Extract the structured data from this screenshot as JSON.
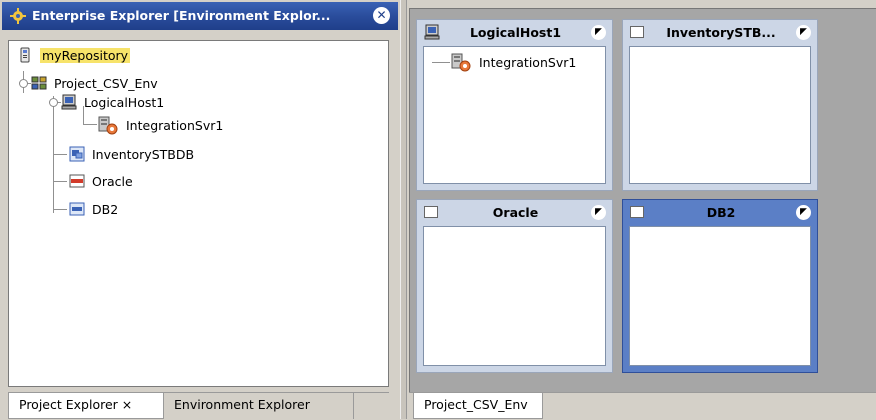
{
  "explorer": {
    "title": "Enterprise Explorer [Environment Explor...",
    "tree": {
      "root": "myRepository",
      "environment": "Project_CSV_Env",
      "logical_host": "LogicalHost1",
      "integration_server": "IntegrationSvr1",
      "external_1": "InventorySTBDB",
      "external_2": "Oracle",
      "external_3": "DB2"
    },
    "tabs": {
      "project": "Project Explorer ×",
      "environment": "Environment Explorer"
    }
  },
  "canvas": {
    "boxes": {
      "logical_host": {
        "title": "LogicalHost1",
        "child": "IntegrationSvr1"
      },
      "inventory": {
        "title": "InventorySTB..."
      },
      "oracle": {
        "title": "Oracle"
      },
      "db2": {
        "title": "DB2"
      }
    },
    "tab": "Project_CSV_Env"
  },
  "colors": {
    "title_bar": "#2a4d9c",
    "highlight": "#f7e36a",
    "selected_box": "#5b7fc6",
    "box": "#ccd6e6"
  }
}
